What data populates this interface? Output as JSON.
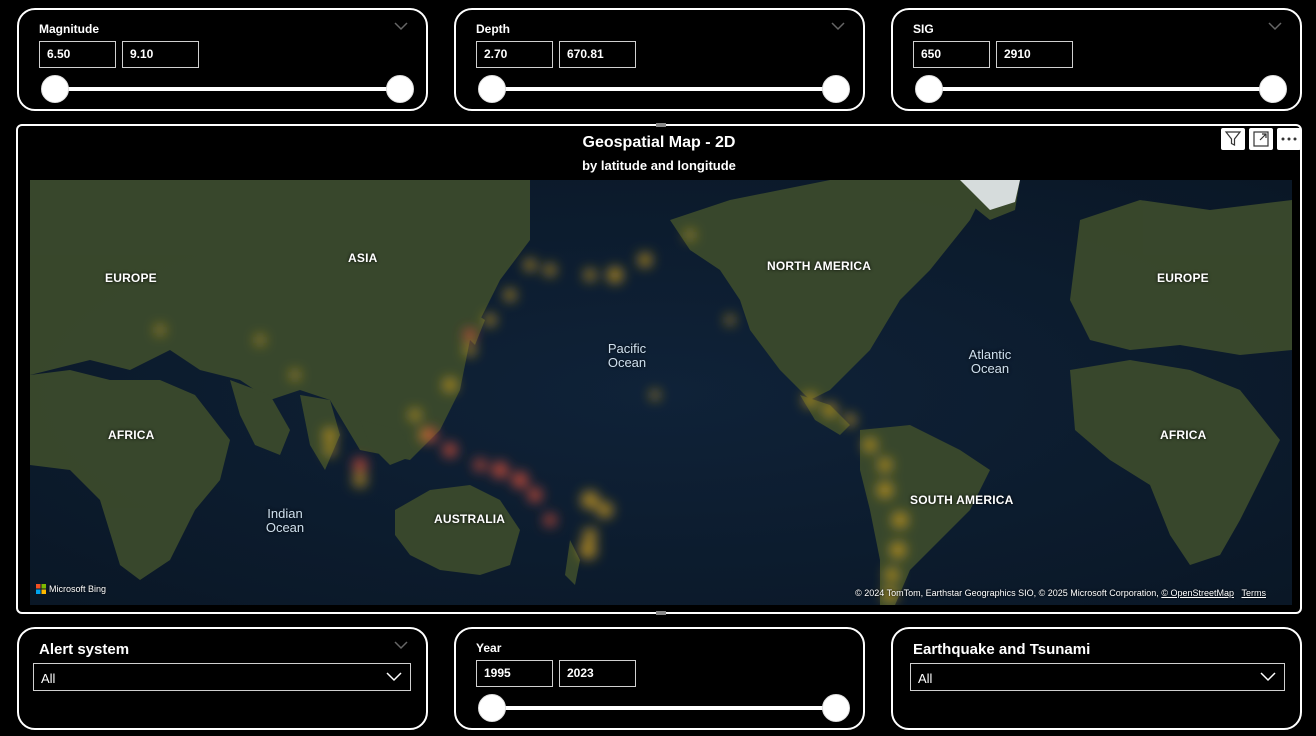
{
  "filters_top": [
    {
      "title": "Magnitude",
      "min": "6.50",
      "max": "9.10"
    },
    {
      "title": "Depth",
      "min": "2.70",
      "max": "670.81"
    },
    {
      "title": "SIG",
      "min": "650",
      "max": "2910"
    }
  ],
  "map": {
    "title": "Geospatial Map - 2D",
    "subtitle": "by latitude and longitude",
    "continent_labels": [
      "EUROPE",
      "ASIA",
      "AFRICA",
      "AUSTRALIA",
      "NORTH AMERICA",
      "SOUTH AMERICA",
      "EUROPE",
      "AFRICA"
    ],
    "ocean_labels": {
      "pacific": [
        "Pacific",
        "Ocean"
      ],
      "atlantic": [
        "Atlantic",
        "Ocean"
      ],
      "indian": [
        "Indian",
        "Ocean"
      ]
    },
    "bing_logo": "Microsoft Bing",
    "attribution": "© 2024 TomTom, Earthstar Geographics SIO, © 2025 Microsoft Corporation, ",
    "osm_link": "© OpenStreetMap",
    "terms_link": "Terms",
    "icons": [
      "filter-icon",
      "focus-mode-icon",
      "more-options-icon"
    ]
  },
  "filters_bottom": {
    "alert": {
      "title": "Alert system",
      "value": "All"
    },
    "year": {
      "title": "Year",
      "min": "1995",
      "max": "2023"
    },
    "tsunami": {
      "title": "Earthquake and Tsunami",
      "value": "All"
    }
  },
  "colors": {
    "background": "#000000",
    "card_border": "#ffffff",
    "heat_hot": "#e0523a",
    "heat_warm": "#d9a520"
  }
}
